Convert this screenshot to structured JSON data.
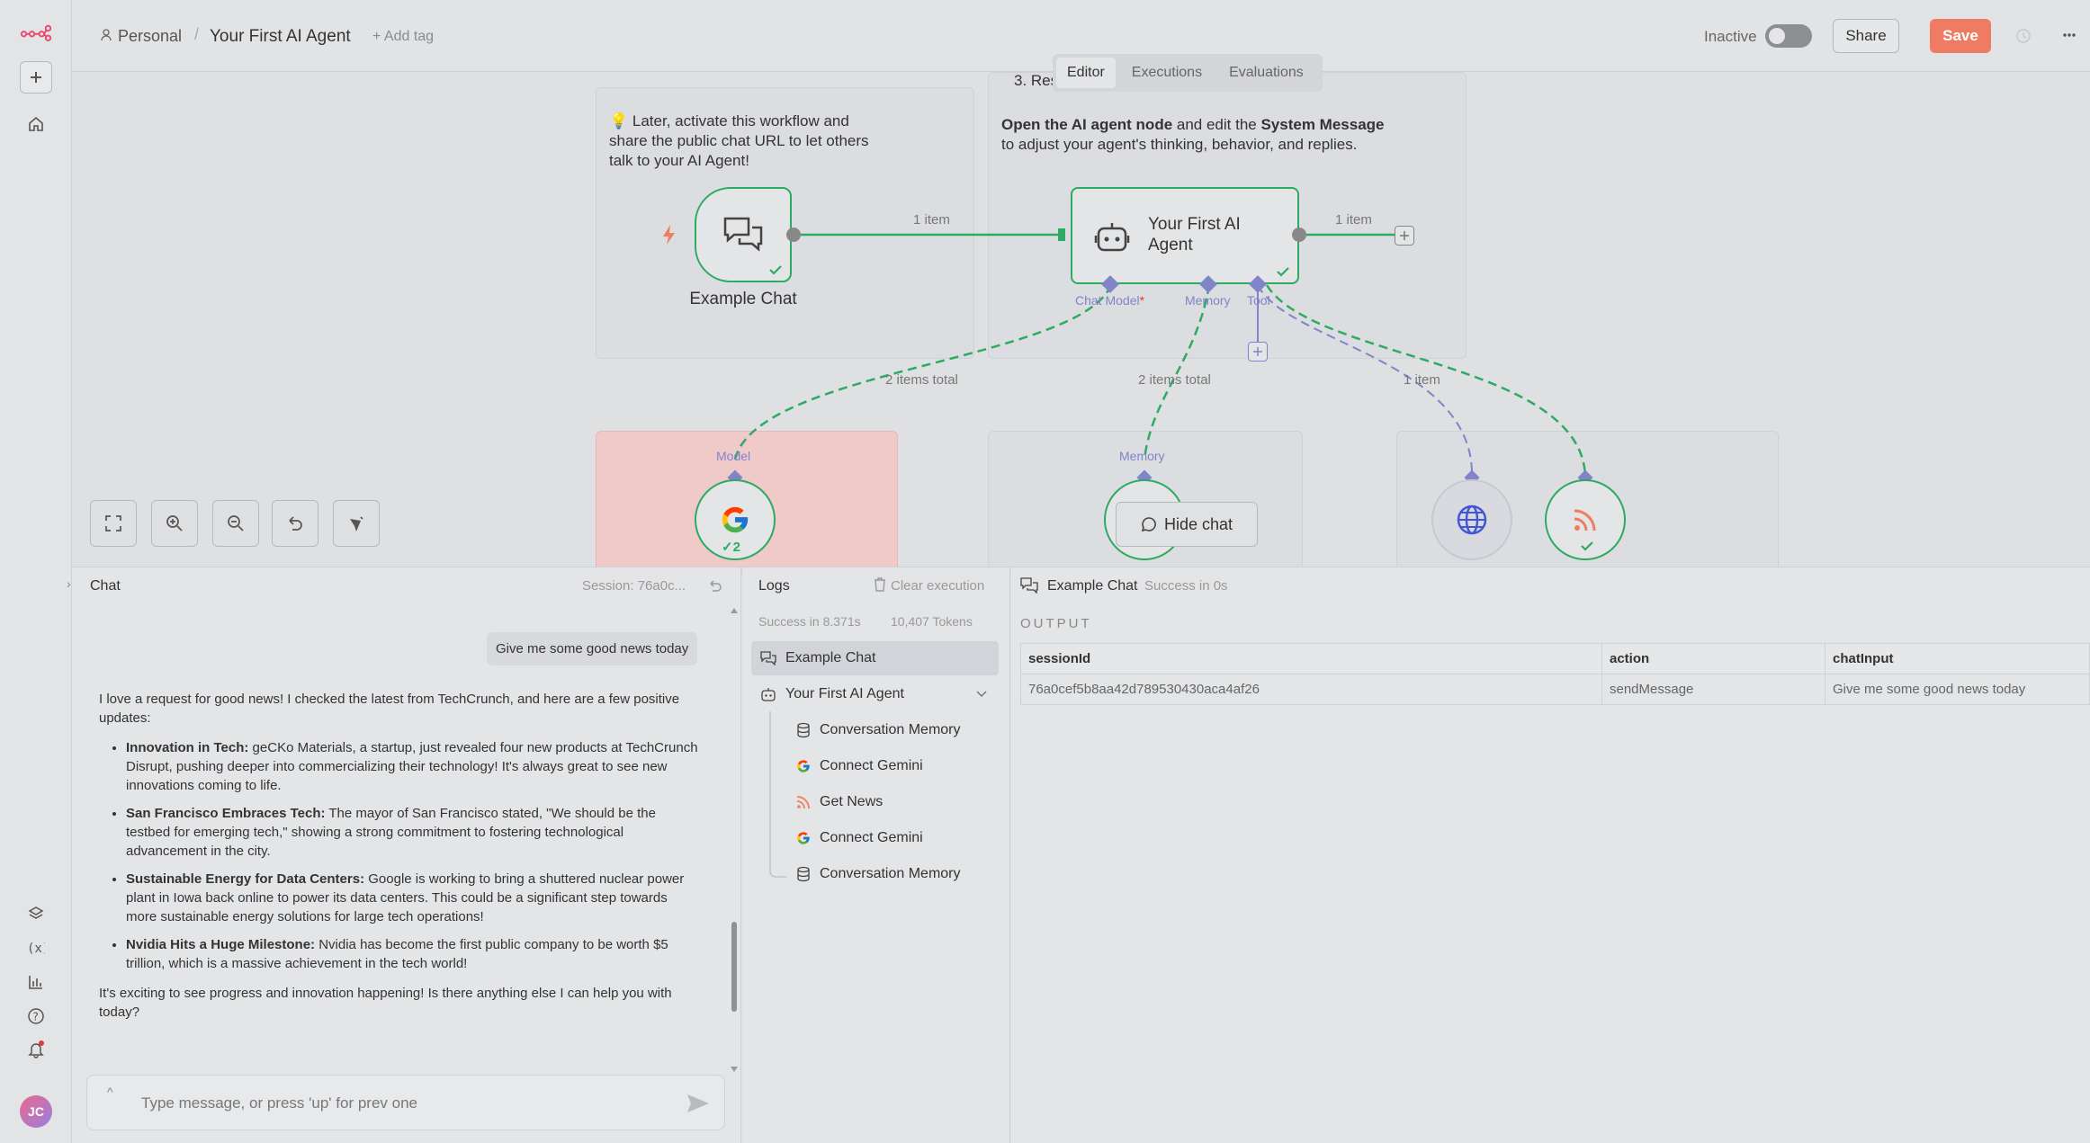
{
  "app": {
    "breadcrumb_project": "Personal",
    "workflow_title": "Your First AI Agent",
    "add_tag": "+ Add tag",
    "status_label": "Inactive",
    "share_label": "Share",
    "save_label": "Save"
  },
  "tabs": [
    {
      "label": "Editor",
      "active": true
    },
    {
      "label": "Executions",
      "active": false
    },
    {
      "label": "Evaluations",
      "active": false
    }
  ],
  "canvas": {
    "sticky_left_text": "💡 Later, activate this workflow and share the public chat URL to let others talk to your AI Agent!",
    "sticky_right_title": "3. Resp",
    "sticky_right_bold1": "Open the AI agent node",
    "sticky_right_mid": " and edit the ",
    "sticky_right_bold2": "System Message",
    "sticky_right_line2": "to adjust your agent's thinking, behavior, and replies.",
    "nodes": {
      "chat_trigger": "Example Chat",
      "agent_line1": "Your First AI",
      "agent_line2": "Agent"
    },
    "edge_labels": {
      "trigger_to_agent": "1 item",
      "agent_out": "1 item",
      "model": "2 items total",
      "memory": "2 items total",
      "tool": "1 item"
    },
    "ports": {
      "chat_model": "Chat Model",
      "required_mark": "*",
      "memory": "Memory",
      "tool": "Tool",
      "model_in": "Model",
      "memory_in": "Memory"
    },
    "gemini_badge": "✓2",
    "hide_chat": "Hide chat"
  },
  "chat": {
    "title": "Chat",
    "session": "Session: 76a0c...",
    "user_message": "Give me some good news today",
    "bot_intro": "I love a request for good news! I checked the latest from TechCrunch, and here are a few positive updates:",
    "bullets": [
      {
        "bold": "Innovation in Tech:",
        "text": " geCKo Materials, a startup, just revealed four new products at TechCrunch Disrupt, pushing deeper into commercializing their technology! It's always great to see new innovations coming to life."
      },
      {
        "bold": "San Francisco Embraces Tech:",
        "text": " The mayor of San Francisco stated, \"We should be the testbed for emerging tech,\" showing a strong commitment to fostering technological advancement in the city."
      },
      {
        "bold": "Sustainable Energy for Data Centers:",
        "text": " Google is working to bring a shuttered nuclear power plant in Iowa back online to power its data centers. This could be a significant step towards more sustainable energy solutions for large tech operations!"
      },
      {
        "bold": "Nvidia Hits a Huge Milestone:",
        "text": " Nvidia has become the first public company to be worth $5 trillion, which is a massive achievement in the tech world!"
      }
    ],
    "bot_outro": "It's exciting to see progress and innovation happening! Is there anything else I can help you with today?",
    "input_placeholder": "Type message, or press 'up' for prev one"
  },
  "logs": {
    "title": "Logs",
    "clear": "Clear execution",
    "status": "Success in 8.371s",
    "tokens": "10,407 Tokens",
    "items": [
      {
        "label": "Example Chat"
      },
      {
        "label": "Your First AI Agent"
      },
      {
        "label": "Conversation Memory"
      },
      {
        "label": "Connect Gemini"
      },
      {
        "label": "Get News"
      },
      {
        "label": "Connect Gemini"
      },
      {
        "label": "Conversation Memory"
      }
    ]
  },
  "output": {
    "node": "Example Chat",
    "status": "Success in 0s",
    "heading": "OUTPUT",
    "columns": [
      "sessionId",
      "action",
      "chatInput"
    ],
    "row": [
      "76a0cef5b8aa42d789530430aca4af26",
      "sendMessage",
      "Give me some good news today"
    ]
  },
  "user": {
    "initials": "JC"
  },
  "colors": {
    "accent": "#ef7c62",
    "node_ok": "#2eaa62",
    "ai_port": "#8084c9"
  }
}
